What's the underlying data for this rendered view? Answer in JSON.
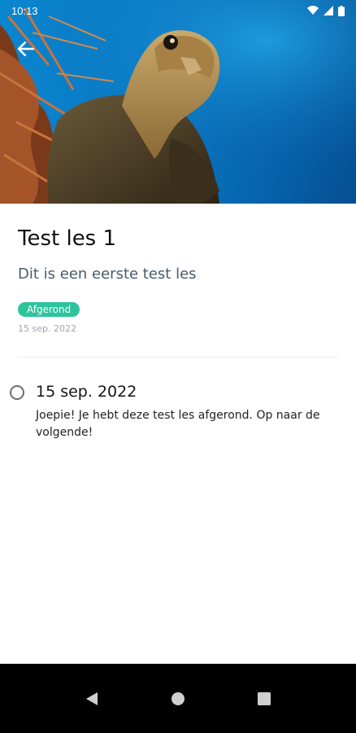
{
  "status_bar": {
    "time": "10:13",
    "icons": [
      "wifi-icon",
      "signal-icon",
      "battery-icon"
    ]
  },
  "hero": {
    "image": "sea-turtle-underwater-photo",
    "back_icon": "arrow-left-icon"
  },
  "lesson": {
    "title": "Test les 1",
    "description": "Dit is een eerste test les",
    "status_badge": "Afgerond",
    "date": "15 sep. 2022"
  },
  "timeline": [
    {
      "date": "15 sep. 2022",
      "text": "Joepie! Je hebt deze test les afgerond. Op naar de volgende!"
    }
  ],
  "colors": {
    "badge": "#2cc39d",
    "hero_water": "#0a7cc8",
    "nav_bar": "#000000"
  },
  "nav_bar": {
    "icons": [
      "back-triangle-icon",
      "home-circle-icon",
      "recents-square-icon"
    ]
  }
}
